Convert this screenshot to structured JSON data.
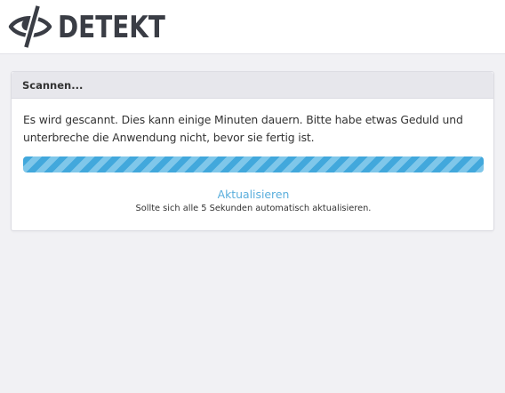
{
  "brand": {
    "name": "DETEKT",
    "logo_icon": "eye-slash-icon"
  },
  "panel": {
    "title": "Scannen...",
    "message": "Es wird gescannt. Dies kann einige Minuten dauern. Bitte habe etwas Geduld und unterbreche die Anwendung nicht, bevor sie fertig ist.",
    "progress_style": "animated-stripes",
    "refresh_link": "Aktualisieren",
    "refresh_note": "Sollte sich alle 5 Sekunden automatisch aktualisieren."
  },
  "colors": {
    "accent": "#42a8dc",
    "link": "#5aaedc",
    "logo": "#3a3d45",
    "background": "#f1f1f4"
  }
}
